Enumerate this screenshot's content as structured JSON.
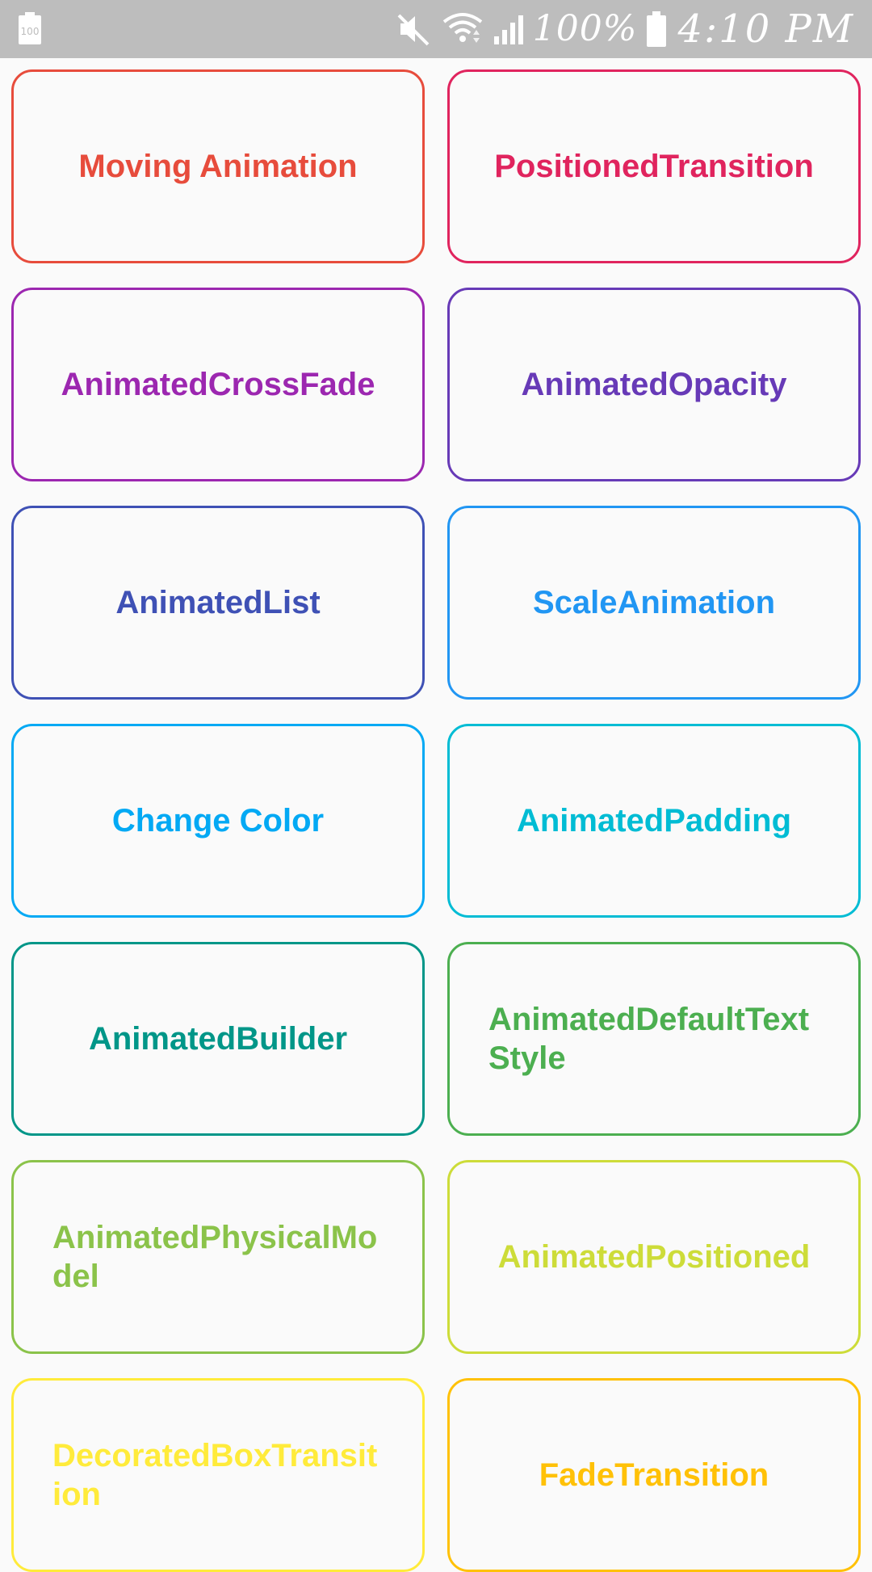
{
  "status_bar": {
    "battery_small_label": "100",
    "battery_percent": "100%",
    "time": "4:10 PM",
    "icons": [
      "battery-icon",
      "mute-icon",
      "wifi-icon",
      "signal-icon",
      "battery-icon"
    ]
  },
  "cards": [
    {
      "label": "Moving Animation",
      "color": "#e74c3c"
    },
    {
      "label": "PositionedTransition",
      "color": "#e0245e"
    },
    {
      "label": "AnimatedCrossFade",
      "color": "#9c27b0"
    },
    {
      "label": "AnimatedOpacity",
      "color": "#673ab7"
    },
    {
      "label": "AnimatedList",
      "color": "#3f51b5"
    },
    {
      "label": "ScaleAnimation",
      "color": "#2196f3"
    },
    {
      "label": "Change Color",
      "color": "#03a9f4"
    },
    {
      "label": "AnimatedPadding",
      "color": "#00bcd4"
    },
    {
      "label": "AnimatedBuilder",
      "color": "#009688"
    },
    {
      "label": "AnimatedDefaultTextStyle",
      "color": "#4caf50"
    },
    {
      "label": "AnimatedPhysicalModel",
      "color": "#8bc34a"
    },
    {
      "label": "AnimatedPositioned",
      "color": "#cddc39"
    },
    {
      "label": "DecoratedBoxTransition",
      "color": "#ffeb3b"
    },
    {
      "label": "FadeTransition",
      "color": "#ffc107"
    }
  ]
}
